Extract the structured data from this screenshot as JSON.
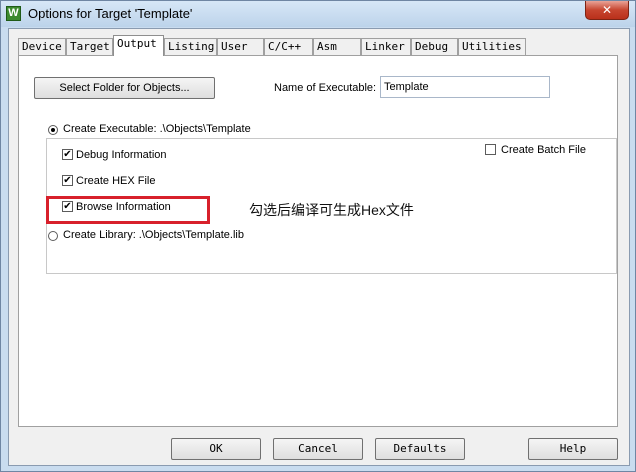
{
  "window": {
    "title": "Options for Target 'Template'",
    "app_icon": "keil-uvision-icon",
    "close_glyph": "✕"
  },
  "tabs": [
    {
      "label": "Device"
    },
    {
      "label": "Target"
    },
    {
      "label": "Output",
      "active": true
    },
    {
      "label": "Listing"
    },
    {
      "label": "User"
    },
    {
      "label": "C/C++"
    },
    {
      "label": "Asm"
    },
    {
      "label": "Linker"
    },
    {
      "label": "Debug"
    },
    {
      "label": "Utilities"
    }
  ],
  "output": {
    "select_folder_label": "Select Folder for Objects...",
    "name_exec_label": "Name of Executable:",
    "name_exec_value": "Template",
    "create_exec_label": "Create Executable:  .\\Objects\\Template",
    "create_exec_selected": true,
    "debug_info_label": "Debug Information",
    "debug_info_checked": true,
    "create_hex_label": "Create HEX File",
    "create_hex_checked": true,
    "browse_info_label": "Browse Information",
    "browse_info_checked": true,
    "create_batch_label": "Create Batch File",
    "create_batch_checked": false,
    "create_library_label": "Create Library:  .\\Objects\\Template.lib",
    "create_library_selected": false,
    "check_glyph": "✔"
  },
  "annotation": {
    "text": "勾选后编译可生成Hex文件",
    "highlight_color": "#d8202b"
  },
  "buttons": {
    "ok": "OK",
    "cancel": "Cancel",
    "defaults": "Defaults",
    "help": "Help"
  }
}
